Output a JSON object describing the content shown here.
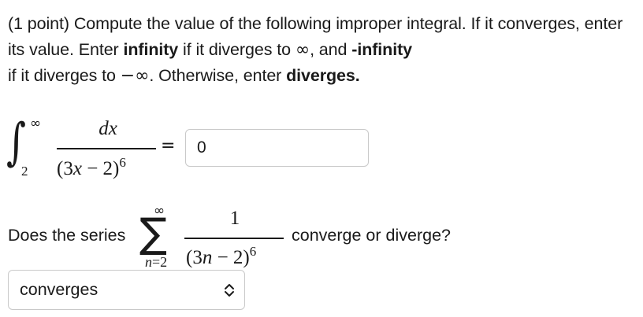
{
  "question": {
    "p1": "(1 point) Compute the value of the following improper integral. If it converges, enter its value. Enter ",
    "kw_infinity": "infinity",
    "p2": " if it diverges to ",
    "inf_symbol": "∞",
    "p3": ", and ",
    "kw_neg_infinity": "-infinity",
    "p4": " if it diverges to ",
    "neg_inf_symbol": "−∞",
    "p5": ". Otherwise, enter ",
    "kw_diverges": "diverges."
  },
  "integral": {
    "sign": "∫",
    "upper": "∞",
    "lower": "2",
    "numerator": "dx",
    "den_open": "(3",
    "den_var": "x",
    "den_rest": " − 2)",
    "den_exp": "6",
    "equals": "=",
    "answer_value": "0"
  },
  "series": {
    "lead_text": "Does the series",
    "sign": "∑",
    "upper": "∞",
    "lower_var": "n",
    "lower_rest": "=2",
    "numerator": "1",
    "den_open": "(3",
    "den_var": "n",
    "den_rest": " − 2)",
    "den_exp": "6",
    "question_text": "converge or diverge?",
    "select_value": "converges",
    "select_icon": "up-down-chevron-icon"
  }
}
